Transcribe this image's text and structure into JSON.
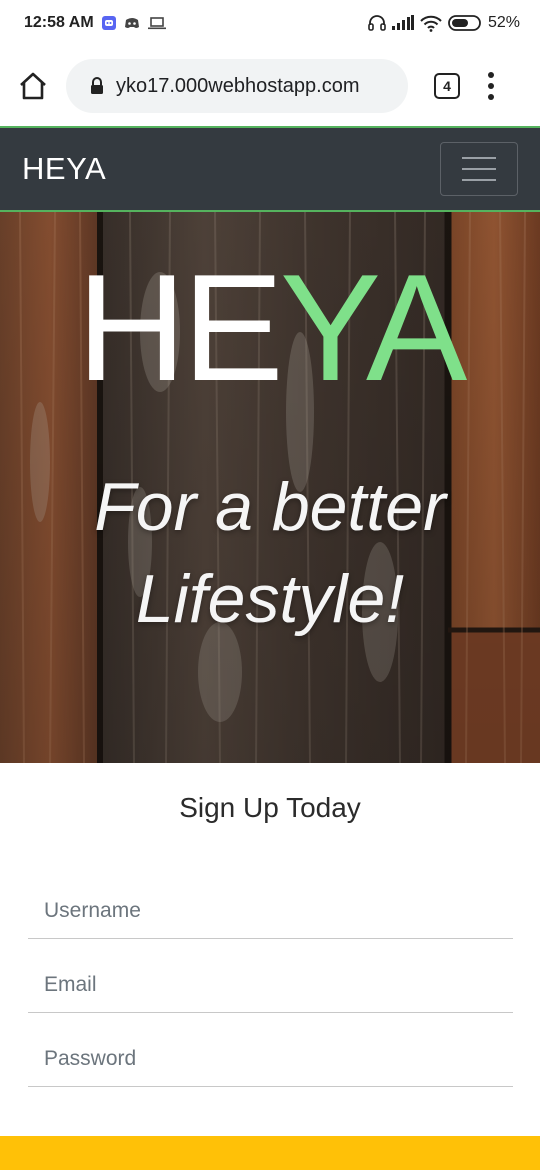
{
  "status_bar": {
    "time": "12:58 AM",
    "battery": "52%",
    "icons_left": [
      "discord-badge-icon",
      "discord-icon",
      "laptop-icon"
    ],
    "icons_right": [
      "headphones-icon",
      "signal-icon",
      "wifi-icon",
      "battery-icon"
    ]
  },
  "browser": {
    "url": "yko17.000webhostapp.com",
    "tab_count": "4",
    "icons": [
      "home-icon",
      "lock-icon",
      "more-vert-icon"
    ]
  },
  "navbar": {
    "brand": "HEYA",
    "background": "#343a40",
    "accent": "#55b35e"
  },
  "hero": {
    "title_white": "HE",
    "title_green": "YA",
    "title_green_color": "#7fe08a",
    "tagline_line1": "For a better",
    "tagline_line2": "Lifestyle!"
  },
  "signup": {
    "heading": "Sign Up Today",
    "username_placeholder": "Username",
    "email_placeholder": "Email",
    "password_placeholder": "Password"
  },
  "footer": {
    "color": "#ffc107"
  }
}
